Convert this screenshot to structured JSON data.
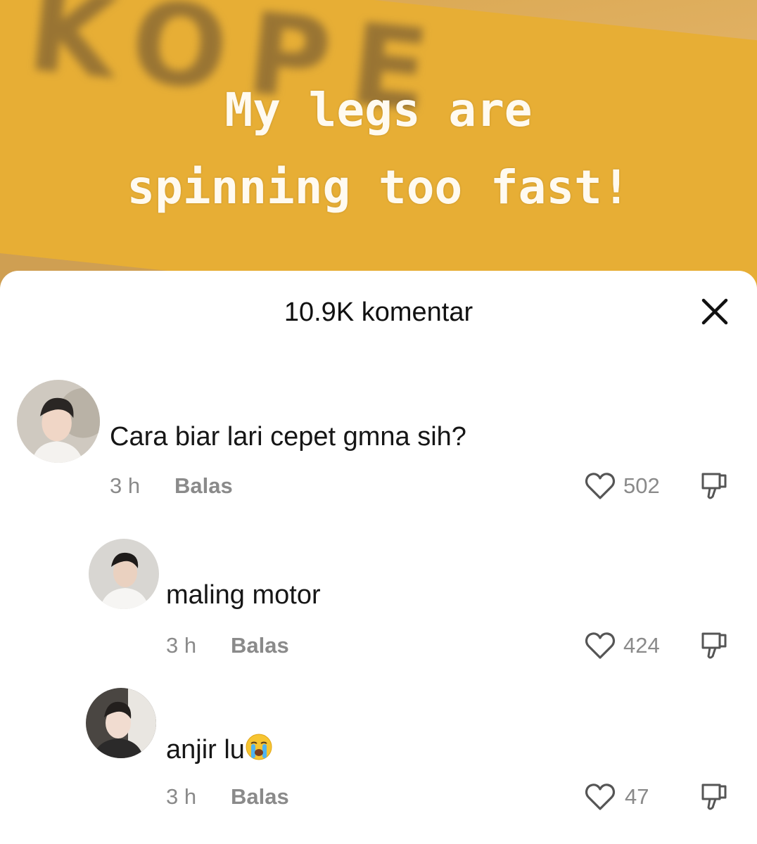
{
  "video": {
    "caption_line1": "My legs are",
    "caption_line2": "spinning too fast!",
    "sign_text": "KOPE"
  },
  "sheet": {
    "title": "10.9K komentar",
    "close_icon": "close-icon"
  },
  "comments": [
    {
      "text": "Cara biar lari cepet gmna sih?",
      "time": "3 h",
      "reply_label": "Balas",
      "likes": "502"
    },
    {
      "text": "maling motor",
      "time": "3 h",
      "reply_label": "Balas",
      "likes": "424"
    },
    {
      "text": "anjir lu",
      "emoji": "loudly-crying-face",
      "time": "3 h",
      "reply_label": "Balas",
      "likes": "47"
    }
  ]
}
